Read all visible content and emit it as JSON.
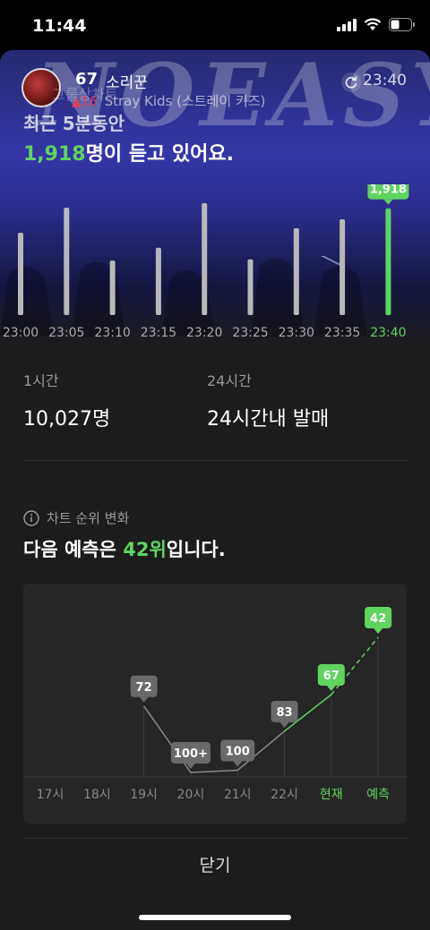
{
  "status_bar": {
    "time": "11:44"
  },
  "song": {
    "rank": "67",
    "title": "소리꾼",
    "change": "▲16",
    "artist": "Stray Kids (스트레이 키즈)",
    "overlap_caption": "그룹상차트"
  },
  "hero": {
    "background_text": "NOEASY",
    "refresh_time": "23:40",
    "period_text": "최근 5분동안",
    "listener_count": "1,918",
    "listener_suffix": "명이 듣고 있어요."
  },
  "chart_data": [
    {
      "type": "bar",
      "categories": [
        "23:00",
        "23:05",
        "23:10",
        "23:15",
        "23:20",
        "23:25",
        "23:30",
        "23:35",
        "23:40"
      ],
      "values": [
        1480,
        1930,
        980,
        1210,
        2010,
        1000,
        1560,
        1720,
        1918
      ],
      "highlight_label": "1,918",
      "highlight_color": "#5fd45f"
    },
    {
      "type": "line",
      "categories": [
        "17시",
        "18시",
        "19시",
        "20시",
        "21시",
        "22시",
        "현재",
        "예측"
      ],
      "values": [
        null,
        null,
        72,
        101,
        100,
        83,
        67,
        42
      ],
      "labels": [
        null,
        null,
        "72",
        "100+",
        "100",
        "83",
        "67",
        "42"
      ],
      "highlight_color": "#5fd45f"
    }
  ],
  "stats": {
    "hour_label": "1시간",
    "hour_value": "10,027명",
    "day_label": "24시간",
    "day_value": "24시간내 발매"
  },
  "rank_change": {
    "section_title": "차트 순위 변화",
    "predict_prefix": "다음 예측은 ",
    "predict_rank": "42위",
    "predict_suffix": "입니다."
  },
  "close_label": "닫기"
}
